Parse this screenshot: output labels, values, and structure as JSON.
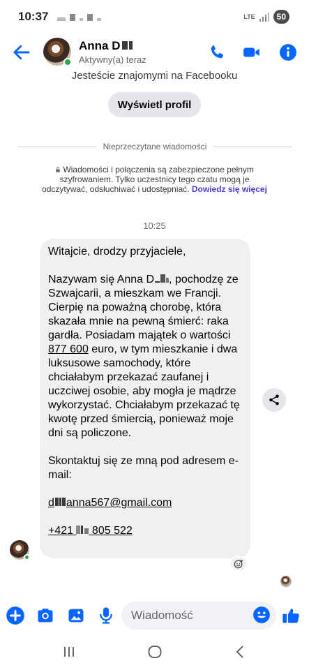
{
  "status_bar": {
    "time": "10:37",
    "network": "LTE",
    "battery": "50"
  },
  "header": {
    "name": "Anna D",
    "presence": "Aktywny(a) teraz"
  },
  "chat": {
    "intro": "Jesteście znajomymi na Facebooku",
    "view_profile": "Wyświetl profil",
    "unread_divider": "Nieprzeczytane wiadomości",
    "encryption_notice": "Wiadomości i połączenia są zabezpieczone pełnym szyfrowaniem. Tylko uczestnicy tego czatu mogą je odczytywać, odsłuchiwać i udostępniać.",
    "encryption_link": "Dowiedz się więcej",
    "time": "10:25",
    "message": {
      "greeting": "Witajcie, drodzy przyjaciele,",
      "body_1": "Nazywam się Anna D",
      "body_2": ", pochodzę ze Szwajcarii, a mieszkam we Francji. Cierpię na poważną chorobę, która skazała mnie na pewną śmierć: raka gardła. Posiadam majątek o wartości ",
      "amount": "877 600",
      "body_3": " euro, w tym mieszkanie i dwa luksusowe samochody, które chciałabym przekazać zaufanej i uczciwej osobie, aby mogła je mądrze wykorzystać. Chciałabym przekazać tę kwotę przed śmiercią, ponieważ moje dni są policzone.",
      "contact": "Skontaktuj się ze mną pod adresem e-mail:",
      "email_prefix": "d",
      "email_suffix": "anna567@gmail.com",
      "phone_prefix": "+421 ",
      "phone_suffix": " 805 522"
    }
  },
  "composer": {
    "placeholder": "Wiadomość"
  },
  "colors": {
    "accent": "#0866ff",
    "bubble": "#f0f0f0",
    "online": "#31a24c"
  }
}
